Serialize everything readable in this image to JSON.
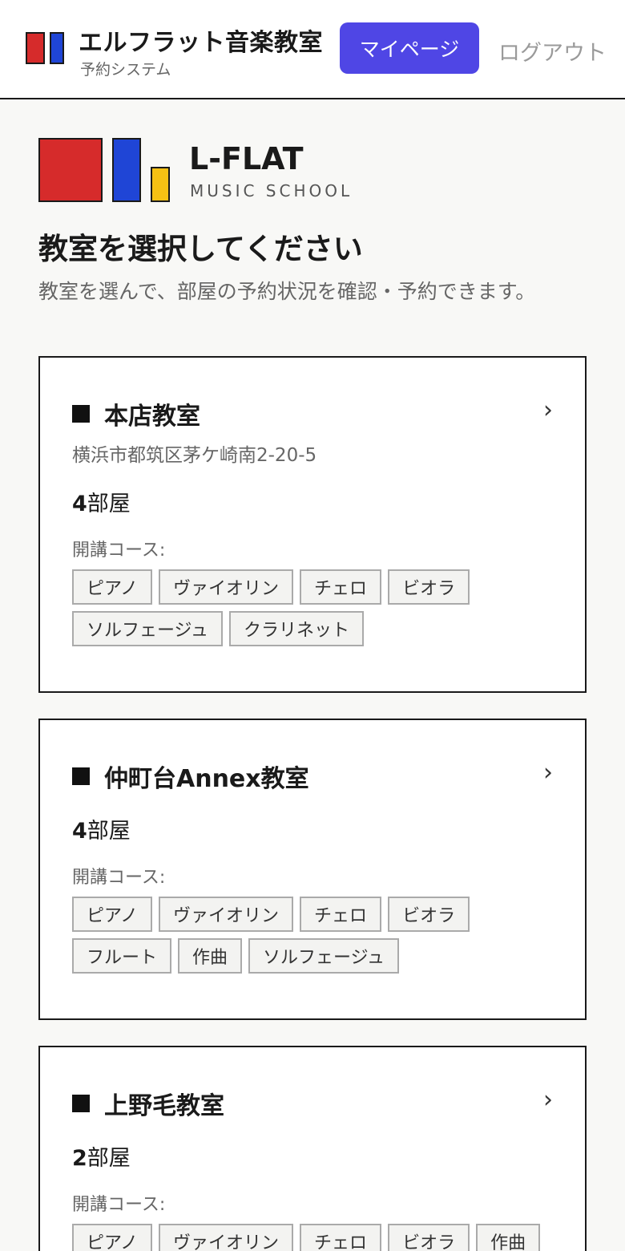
{
  "header": {
    "app_title": "エルフラット音楽教室",
    "app_subtitle": "予約システム",
    "mypage_label": "マイページ",
    "logout_label": "ログアウト"
  },
  "brand": {
    "name": "L-FLAT",
    "tagline": "MUSIC SCHOOL",
    "colors": {
      "red": "#d62b2b",
      "blue": "#1f45d6",
      "yellow": "#f6c114"
    }
  },
  "page": {
    "title": "教室を選択してください",
    "description": "教室を選んで、部屋の予約状況を確認・予約できます。"
  },
  "classrooms": [
    {
      "name": "本店教室",
      "address": "横浜市都筑区茅ケ崎南2-20-5",
      "room_count": "4",
      "room_unit": "部屋",
      "courses_label": "開講コース:",
      "courses": [
        "ピアノ",
        "ヴァイオリン",
        "チェロ",
        "ビオラ",
        "ソルフェージュ",
        "クラリネット"
      ]
    },
    {
      "name": "仲町台Annex教室",
      "room_count": "4",
      "room_unit": "部屋",
      "courses_label": "開講コース:",
      "courses": [
        "ピアノ",
        "ヴァイオリン",
        "チェロ",
        "ビオラ",
        "フルート",
        "作曲",
        "ソルフェージュ"
      ]
    },
    {
      "name": "上野毛教室",
      "room_count": "2",
      "room_unit": "部屋",
      "courses_label": "開講コース:",
      "courses": [
        "ピアノ",
        "ヴァイオリン",
        "チェロ",
        "ビオラ",
        "作曲"
      ]
    }
  ],
  "icons": {
    "chevron": "chevron-right-icon",
    "bullet": "square-bullet-icon"
  },
  "accent_color": "#4f46e5"
}
